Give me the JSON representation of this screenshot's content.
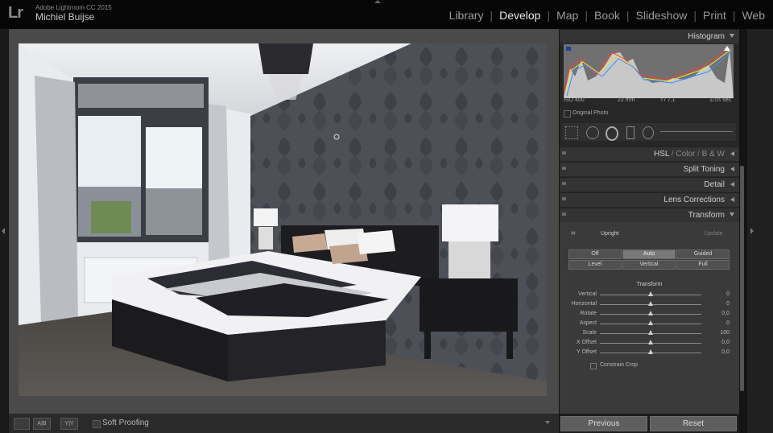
{
  "app": {
    "title": "Adobe Lightroom CC 2015",
    "user": "Michiel Buijse",
    "logo": "Lr"
  },
  "modules": [
    "Library",
    "Develop",
    "Map",
    "Book",
    "Slideshow",
    "Print",
    "Web"
  ],
  "active_module": "Develop",
  "toolbar": {
    "soft_proofing": "Soft Proofing",
    "ab_label": "A|B",
    "yy_label": "Y|Y"
  },
  "panel": {
    "histogram": {
      "title": "Histogram",
      "iso": "ISO 400",
      "focal": "22 mm",
      "aperture": "f / 7,1",
      "shutter_top": "1",
      "shutter_bottom": "125",
      "shutter_unit": "sec",
      "original_photo": "Original Photo"
    },
    "hsl_title": {
      "hsl": "HSL",
      "color": "Color",
      "bw": "B & W"
    },
    "sections": [
      "Split Toning",
      "Detail",
      "Lens Corrections",
      "Transform"
    ],
    "transform": {
      "upright_label": "Upright",
      "update_label": "Update",
      "row1": [
        "Off",
        "Auto",
        "Guided"
      ],
      "row2": [
        "Level",
        "Vertical",
        "Full"
      ],
      "active_button": "Auto",
      "transform_label": "Transform",
      "sliders": [
        {
          "label": "Vertical",
          "value": "0"
        },
        {
          "label": "Horizontal",
          "value": "0"
        },
        {
          "label": "Rotate",
          "value": "0,0"
        },
        {
          "label": "Aspect",
          "value": "0"
        },
        {
          "label": "Scale",
          "value": "100"
        },
        {
          "label": "X Offset",
          "value": "0,0"
        },
        {
          "label": "Y Offset",
          "value": "0,0"
        }
      ],
      "constrain_crop": "Constrain Crop"
    }
  },
  "buttons": {
    "previous": "Previous",
    "reset": "Reset"
  }
}
